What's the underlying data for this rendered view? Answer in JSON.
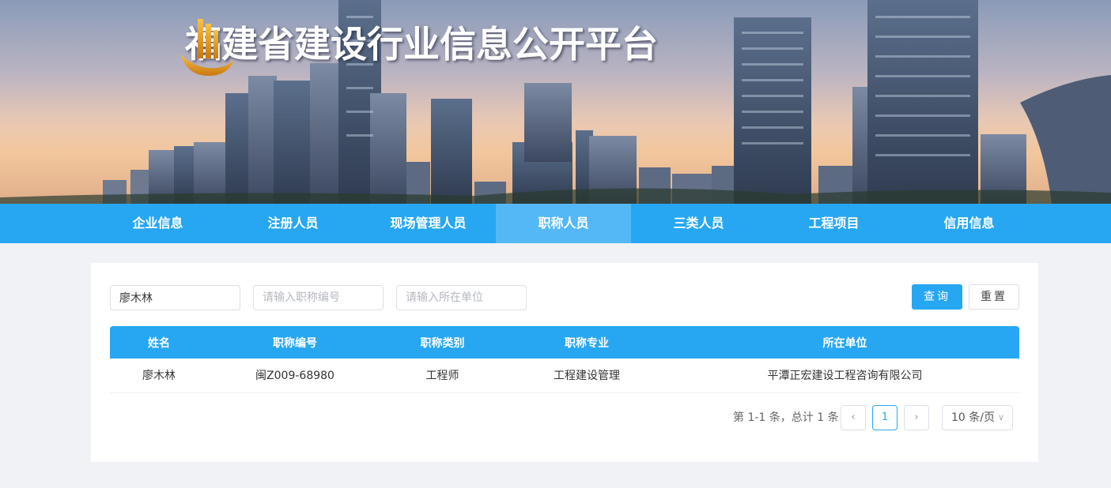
{
  "site": {
    "title": "福建省建设行业信息公开平台"
  },
  "nav": {
    "items": [
      {
        "label": "企业信息"
      },
      {
        "label": "注册人员"
      },
      {
        "label": "现场管理人员"
      },
      {
        "label": "职称人员",
        "active": true
      },
      {
        "label": "三类人员"
      },
      {
        "label": "工程项目"
      },
      {
        "label": "信用信息"
      }
    ]
  },
  "search": {
    "name_value": "廖木林",
    "code_placeholder": "请输入职称编号",
    "unit_placeholder": "请输入所在单位",
    "query_label": "查询",
    "reset_label": "重置"
  },
  "table": {
    "headers": [
      "姓名",
      "职称编号",
      "职称类别",
      "职称专业",
      "所在单位"
    ],
    "rows": [
      [
        "廖木林",
        "闽Z009-68980",
        "工程师",
        "工程建设管理",
        "平潭正宏建设工程咨询有限公司"
      ]
    ]
  },
  "pagination": {
    "total_text": "第 1-1 条，总计 1 条",
    "current_page": "1",
    "page_size": "10 条/页"
  },
  "colors": {
    "accent": "#27a7f2",
    "nav_active": "#55b8f6",
    "page_bg": "#f0f2f5"
  }
}
